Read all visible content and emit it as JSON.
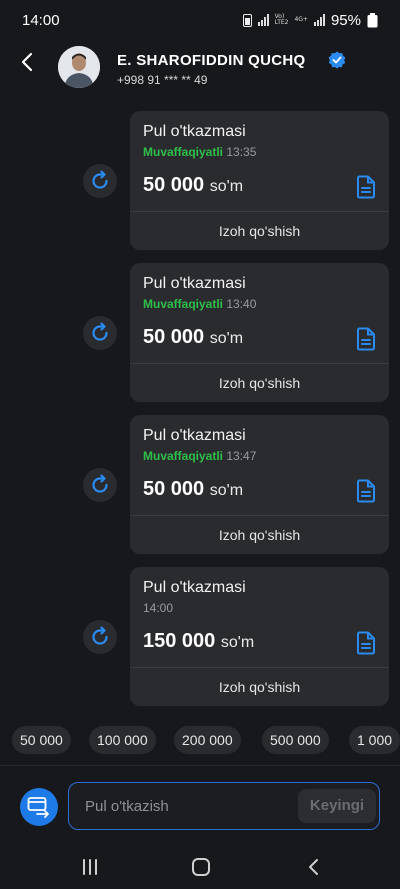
{
  "status_bar": {
    "time": "14:00",
    "network_1": "Vo)",
    "network_2": "LTE2",
    "network_3": "4G+",
    "battery": "95%"
  },
  "header": {
    "name": "E. SHAROFIDDIN QUCHQ",
    "phone": "+998 91 *** ** 49"
  },
  "messages": [
    {
      "title": "Pul o'tkazmasi",
      "status": "Muvaffaqiyatli",
      "time": "13:35",
      "amount": "50 000",
      "currency": "so'm",
      "comment": "Izoh qo'shish"
    },
    {
      "title": "Pul o'tkazmasi",
      "status": "Muvaffaqiyatli",
      "time": "13:40",
      "amount": "50 000",
      "currency": "so'm",
      "comment": "Izoh qo'shish"
    },
    {
      "title": "Pul o'tkazmasi",
      "status": "Muvaffaqiyatli",
      "time": "13:47",
      "amount": "50 000",
      "currency": "so'm",
      "comment": "Izoh qo'shish"
    },
    {
      "title": "Pul o'tkazmasi",
      "status": "",
      "time": "14:00",
      "amount": "150 000",
      "currency": "so'm",
      "comment": "Izoh qo'shish"
    }
  ],
  "quick_amounts": [
    "50 000",
    "100 000",
    "200 000",
    "500 000",
    "1 000"
  ],
  "composer": {
    "placeholder": "Pul o'tkazish",
    "next_label": "Keyingi"
  },
  "colors": {
    "accent": "#1e7ae6",
    "success": "#2fbf4a",
    "background": "#17181b",
    "bubble": "#2a2b2f"
  },
  "icons": {
    "back": "chevron-left-icon",
    "verified": "verified-badge-icon",
    "repeat": "repeat-icon",
    "receipt": "document-icon",
    "pay": "card-transfer-icon"
  }
}
